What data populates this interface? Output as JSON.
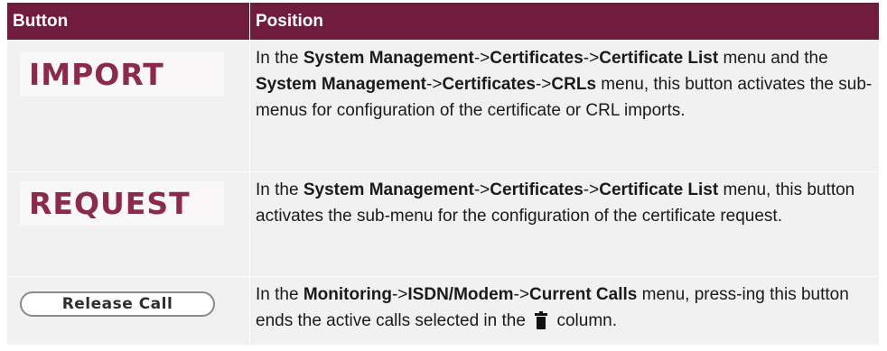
{
  "table": {
    "headers": {
      "button": "Button",
      "position": "Position"
    },
    "rows": [
      {
        "button_image_text": "IMPORT",
        "description": {
          "p1": "In the ",
          "b1": "System Management",
          "p2": "->",
          "b2": "Certificates",
          "p3": "->",
          "b3": "Certificate List",
          "p4": " menu and the ",
          "b4": "System Management",
          "p5": "->",
          "b5": "Certificates",
          "p6": "->",
          "b6": "CRLs",
          "p7": " menu, this button activates the sub-menus for configuration of the certificate or CRL imports."
        }
      },
      {
        "button_image_text": "REQUEST",
        "description": {
          "p1": "In the ",
          "b1": "System Management",
          "p2": "->",
          "b2": "Certificates",
          "p3": "->",
          "b3": "Certificate List",
          "p4": " menu, this button activates the sub-menu for the configuration of the certificate request."
        }
      },
      {
        "button_label": "Release Call",
        "description": {
          "p1": "In the ",
          "b1": "Monitoring",
          "p2": "->",
          "b2": "ISDN/Modem",
          "p3": "->",
          "b3": "Current Calls",
          "p4": " menu, press-ing this button ends the active calls selected in the ",
          "icon": "trash-icon",
          "p5": " column."
        }
      }
    ]
  },
  "colors": {
    "header_bg": "#711c3e",
    "row_bg": "#f1f1f1",
    "button_text": "#8a2a4c"
  }
}
